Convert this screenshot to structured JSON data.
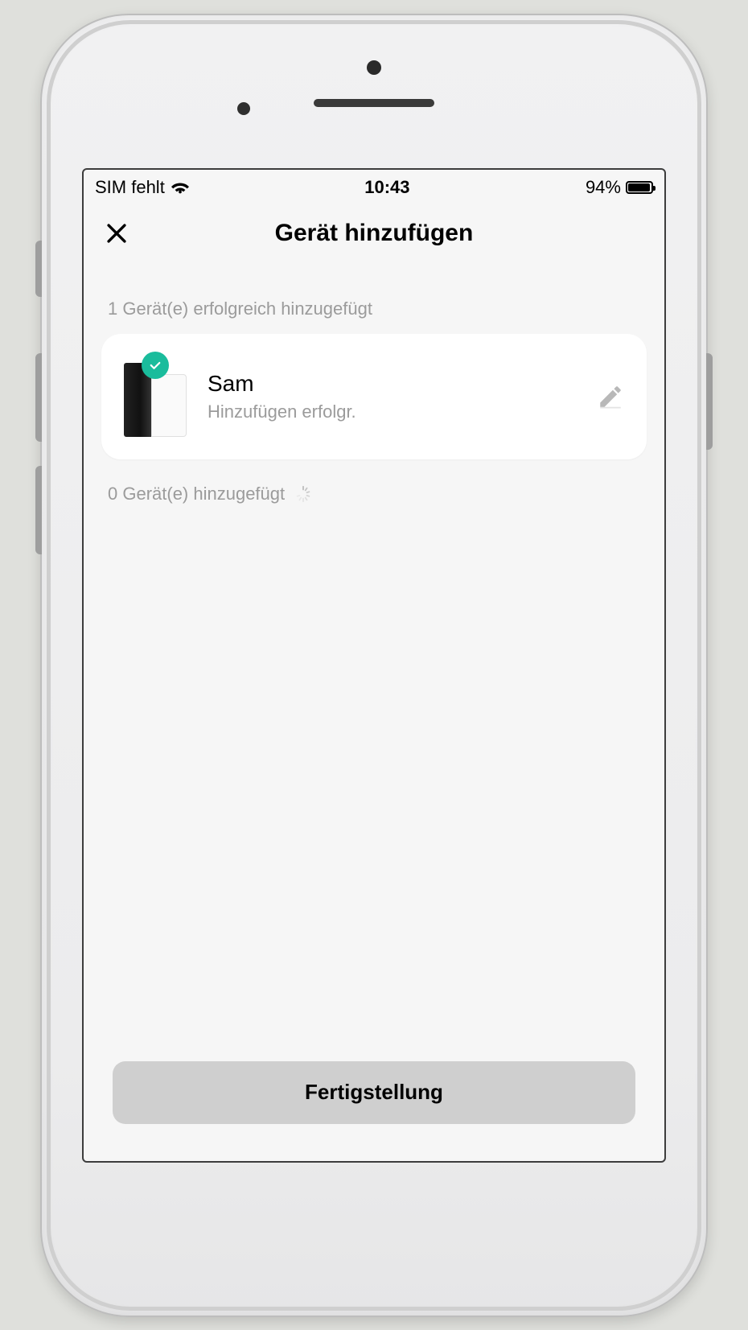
{
  "statusbar": {
    "carrier": "SIM fehlt",
    "time": "10:43",
    "battery_pct": "94%"
  },
  "nav": {
    "title": "Gerät hinzufügen"
  },
  "sections": {
    "success_header": "1 Gerät(e) erfolgreich hinzugefügt",
    "pending_header": "0 Gerät(e) hinzugefügt"
  },
  "device": {
    "name": "Sam",
    "status": "Hinzufügen erfolgr."
  },
  "footer": {
    "finish_label": "Fertigstellung"
  },
  "icons": {
    "close": "close-icon",
    "wifi": "wifi-icon",
    "battery": "battery-icon",
    "check": "check-icon",
    "edit": "pencil-icon",
    "spinner": "spinner-icon"
  }
}
